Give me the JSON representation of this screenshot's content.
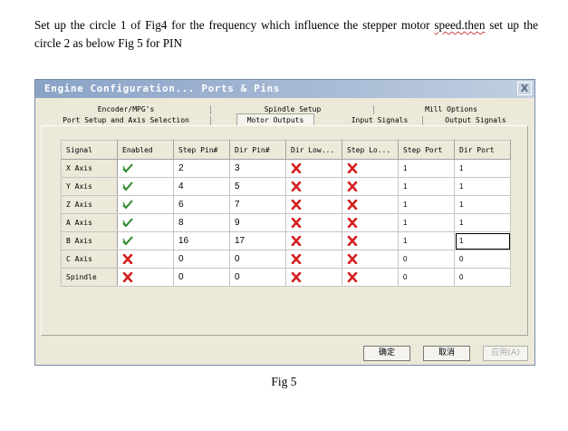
{
  "intro": {
    "before": "Set up the circle 1 of Fig4 for the frequency which influence the stepper motor ",
    "squiggled": "speed.then",
    "after": " set up the circle 2 as below Fig 5 for PIN"
  },
  "dialog": {
    "title": "Engine Configuration... Ports & Pins",
    "close_label": "X",
    "tabs_top": [
      "Encoder/MPG's",
      "Spindle Setup",
      "Mill Options"
    ],
    "tabs_bottom": [
      "Port Setup and Axis Selection",
      "Motor Outputs",
      "Input Signals",
      "Output Signals"
    ],
    "active_tab": "Motor Outputs",
    "table": {
      "headers": [
        "Signal",
        "Enabled",
        "Step Pin#",
        "Dir Pin#",
        "Dir Low...",
        "Step Lo...",
        "Step Port",
        "Dir Port"
      ],
      "rows": [
        {
          "signal": "X Axis",
          "enabled": "check-icon",
          "step_pin": "2",
          "dir_pin": "3",
          "dir_low": "x-icon",
          "step_low": "x-icon",
          "step_port": "1",
          "dir_port": "1"
        },
        {
          "signal": "Y Axis",
          "enabled": "check-icon",
          "step_pin": "4",
          "dir_pin": "5",
          "dir_low": "x-icon",
          "step_low": "x-icon",
          "step_port": "1",
          "dir_port": "1"
        },
        {
          "signal": "Z Axis",
          "enabled": "check-icon",
          "step_pin": "6",
          "dir_pin": "7",
          "dir_low": "x-icon",
          "step_low": "x-icon",
          "step_port": "1",
          "dir_port": "1"
        },
        {
          "signal": "A Axis",
          "enabled": "check-icon",
          "step_pin": "8",
          "dir_pin": "9",
          "dir_low": "x-icon",
          "step_low": "x-icon",
          "step_port": "1",
          "dir_port": "1"
        },
        {
          "signal": "B Axis",
          "enabled": "check-icon",
          "step_pin": "16",
          "dir_pin": "17",
          "dir_low": "x-icon",
          "step_low": "x-icon",
          "step_port": "1",
          "dir_port": "1"
        },
        {
          "signal": "C Axis",
          "enabled": "x-icon",
          "step_pin": "0",
          "dir_pin": "0",
          "dir_low": "x-icon",
          "step_low": "x-icon",
          "step_port": "0",
          "dir_port": "0"
        },
        {
          "signal": "Spindle",
          "enabled": "x-icon",
          "step_pin": "0",
          "dir_pin": "0",
          "dir_low": "x-icon",
          "step_low": "x-icon",
          "step_port": "0",
          "dir_port": "0"
        }
      ]
    },
    "buttons": {
      "ok": "确定",
      "cancel": "取消",
      "apply": "应用(A)"
    }
  },
  "caption": "Fig 5",
  "colors": {
    "check": "#2f8a2f",
    "cross": "#d42020",
    "titlebar": "#8aa3c6",
    "dialog_bg": "#ece9d8"
  }
}
